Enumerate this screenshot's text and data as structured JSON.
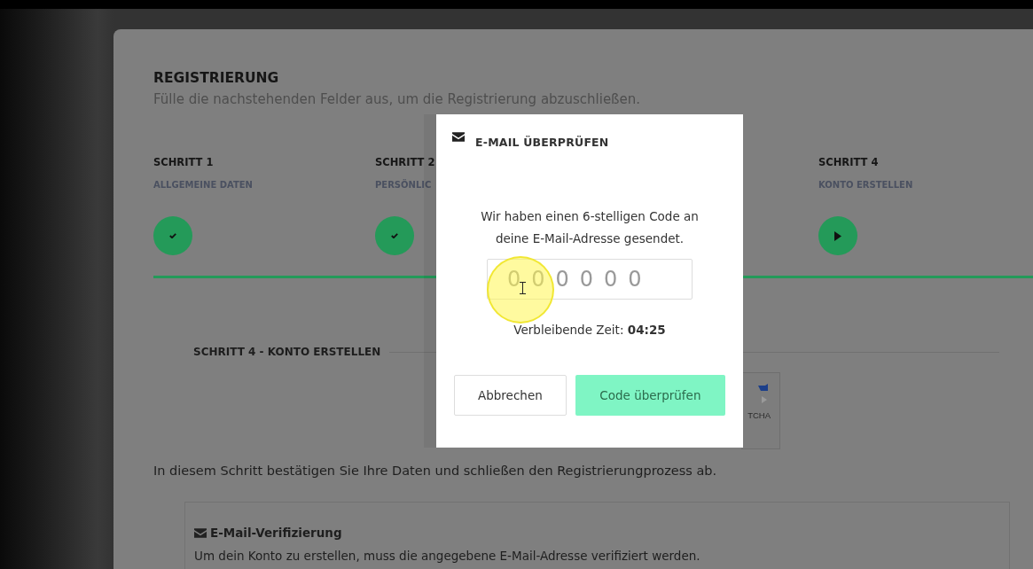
{
  "page": {
    "title": "REGISTRIERUNG",
    "subtitle": "Fülle die nachstehenden Felder aus, um die Registrierung abzuschließen.",
    "steps": [
      {
        "title": "SCHRITT 1",
        "label": "ALLGEMEINE DATEN",
        "kind": "done"
      },
      {
        "title": "SCHRITT 2",
        "label": "PERSÖNLIC",
        "kind": "done"
      },
      {
        "title": "SCHRITT 4",
        "label": "KONTO ERSTELLEN",
        "kind": "current"
      }
    ],
    "section_title": "SCHRITT 4 - KONTO ERSTELLEN",
    "recaptcha": {
      "text": "TCHA"
    },
    "intro": "In diesem Schritt bestätigen Sie Ihre Daten und schließen den Registrierungprozess ab.",
    "verification_box": {
      "heading": "E-Mail-Verifizierung",
      "text": "Um dein Konto zu erstellen, muss die angegebene E-Mail-Adresse verifiziert werden."
    }
  },
  "modal": {
    "title": "E-MAIL ÜBERPRÜFEN",
    "message": "Wir haben einen 6-stelligen Code an deine E-Mail-Adresse gesendet.",
    "code_field": {
      "placeholder": "000000"
    },
    "timer": "Verbleibende Zeit: **04:25**",
    "buttons": [
      {
        "label": "Abbrechen",
        "kind": "secondary"
      },
      {
        "label": "Code überprüfen",
        "kind": "primary"
      }
    ]
  }
}
